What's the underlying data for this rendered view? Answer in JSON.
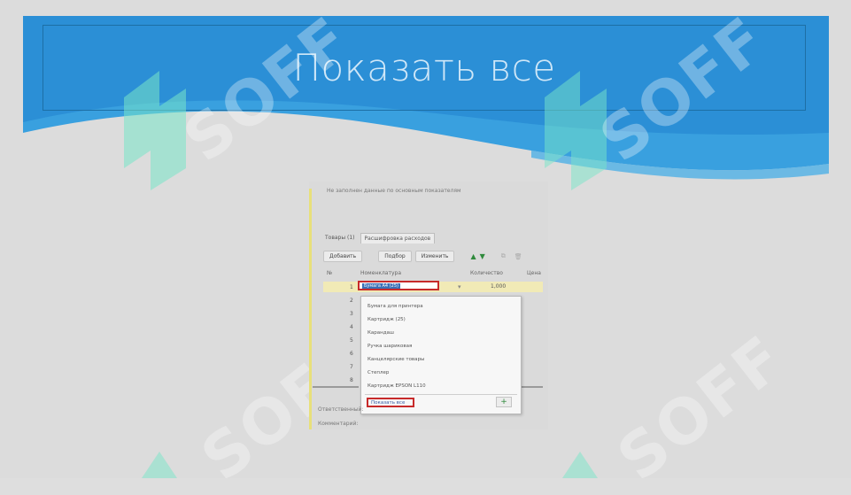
{
  "slide": {
    "title": "Показать все",
    "colors": {
      "banner": "#2b8fd6",
      "banner_dark": "#1d6fa5",
      "wave": "#39a0df",
      "background": "#dcdcdc"
    }
  },
  "watermarks": [
    {
      "text": "SOFF"
    },
    {
      "text": "SOFF"
    },
    {
      "text": "SOFF"
    },
    {
      "text": "SOFF"
    }
  ],
  "embedded_screen": {
    "hint": "Не заполнен данные по основным показателям",
    "tabs": [
      {
        "label": "Товары (1)",
        "active": false
      },
      {
        "label": "Расшифровка расходов",
        "active": true
      }
    ],
    "toolbar": {
      "add_label": "Добавить",
      "pick_label": "Подбор",
      "change_label": "Изменить",
      "up_icon": "▲",
      "down_icon": "▼"
    },
    "columns": {
      "num": "№",
      "item": "Номенклатура",
      "qty": "Количество",
      "price": "Цена"
    },
    "row1": {
      "num": "1",
      "value": "Бумага A4 (25)",
      "amount": "1,000"
    },
    "row_numbers": [
      "2",
      "3",
      "4",
      "5",
      "6",
      "7",
      "8"
    ],
    "dropdown": {
      "items": [
        "Бумага для принтера",
        "Картридж (25)",
        "Карандаш",
        "Ручка шариковая",
        "Канцелярские товары",
        "Степлер",
        "Картридж EPSON L110"
      ],
      "show_all_label": "Показать все",
      "plus_icon": "+"
    },
    "bottom": {
      "label1": "Ответственный:",
      "label2": "Комментарий:"
    }
  }
}
